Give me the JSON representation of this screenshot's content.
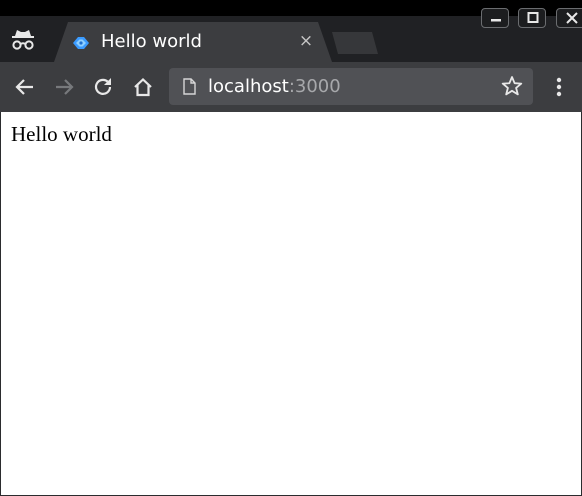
{
  "tab": {
    "title": "Hello world",
    "close_glyph": "×"
  },
  "omnibox": {
    "host": "localhost",
    "port": ":3000"
  },
  "page": {
    "body_text": "Hello world"
  },
  "icons": {
    "incognito": "incognito-icon",
    "favicon": "favicon-icon",
    "back": "back-arrow-icon",
    "forward": "forward-arrow-icon",
    "reload": "reload-icon",
    "home": "home-icon",
    "page_info": "page-info-icon",
    "bookmark": "star-icon",
    "menu": "kebab-menu-icon"
  },
  "colors": {
    "tabstrip": "#202124",
    "toolbar": "#3c3d40",
    "omnibox": "#505155",
    "favicon": "#3b9bff"
  }
}
